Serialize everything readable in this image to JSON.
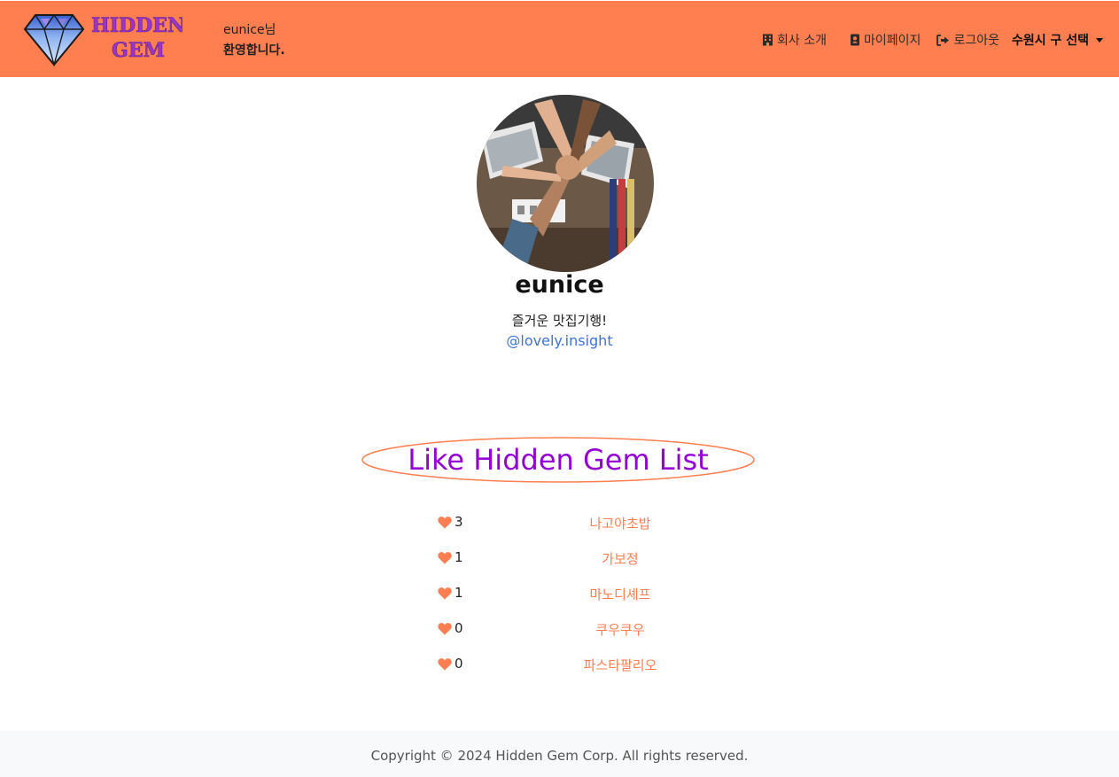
{
  "brand": {
    "logo_alt": "Hidden Gem logo",
    "logo_line1": "HIDDEN",
    "logo_line2": "GEM",
    "primary_color": "#ff7f50",
    "logo_text_color": "#9b35c9"
  },
  "header": {
    "welcome_user": "eunice님",
    "welcome_msg": "환영합니다.",
    "nav": {
      "about": "회사 소개",
      "mypage": "마이페이지",
      "logout": "로그아웃",
      "region_select": "수원시 구 선택"
    }
  },
  "profile": {
    "name": "eunice",
    "bio": "즐거운 맛집기행!",
    "handle": "@lovely.insight",
    "handle_color": "#3d73d4"
  },
  "like_list": {
    "title": "Like Hidden Gem List",
    "title_color": "#9400d3",
    "heart_icon": "heart-icon",
    "items": [
      {
        "count": "3",
        "name": "나고야초밥"
      },
      {
        "count": "1",
        "name": "가보정"
      },
      {
        "count": "1",
        "name": "마노디셰프"
      },
      {
        "count": "0",
        "name": "쿠우쿠우"
      },
      {
        "count": "0",
        "name": "파스타팔리오"
      }
    ]
  },
  "footer": {
    "copyright": "Copyright © 2024 Hidden Gem Corp. All rights reserved."
  }
}
